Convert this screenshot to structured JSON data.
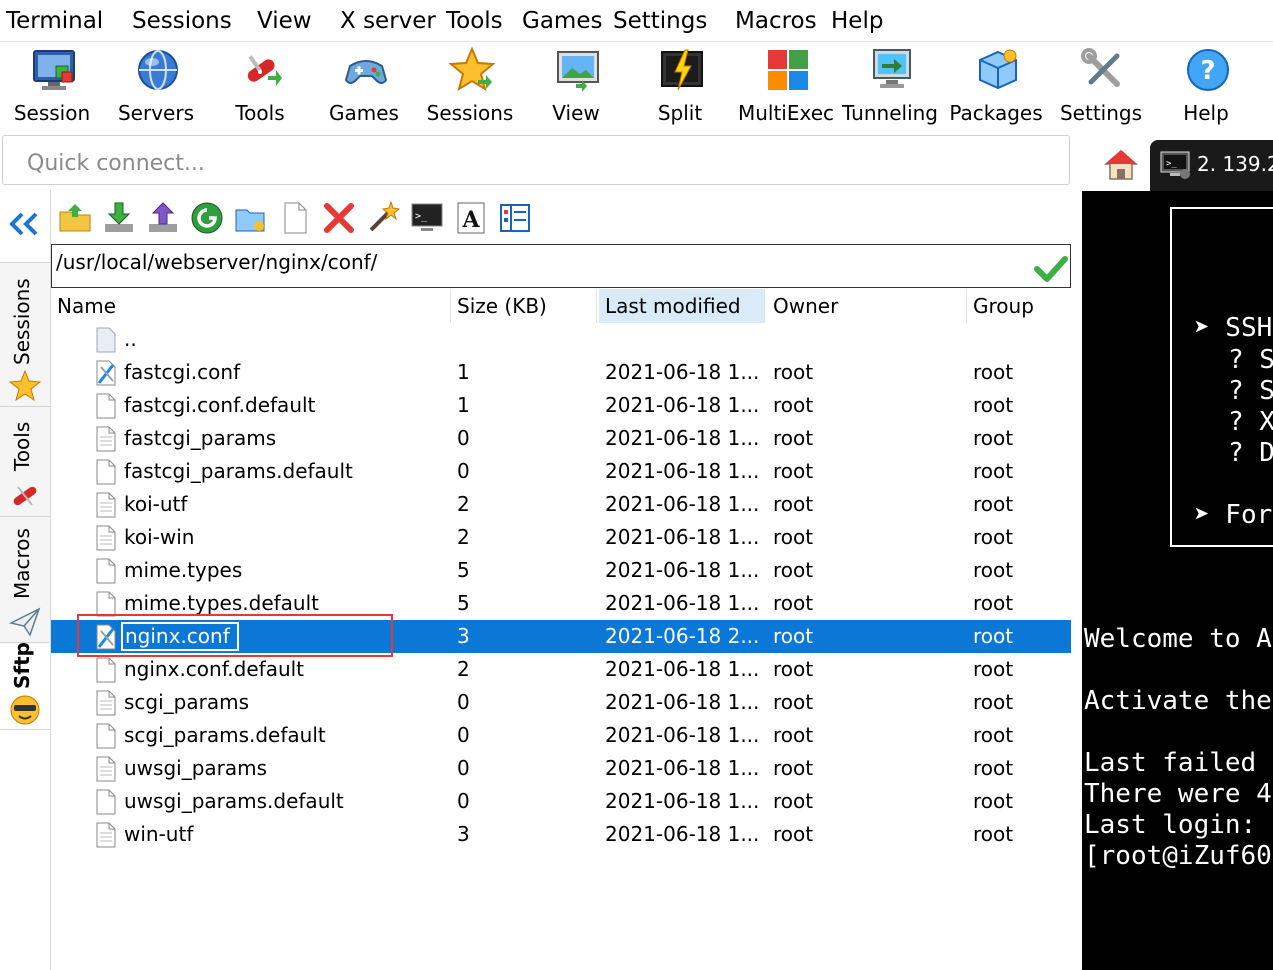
{
  "menu": [
    "Terminal",
    "Sessions",
    "View",
    "X server",
    "Tools",
    "Games",
    "Settings",
    "Macros",
    "Help"
  ],
  "toolbar": [
    "Session",
    "Servers",
    "Tools",
    "Games",
    "Sessions",
    "View",
    "Split",
    "MultiExec",
    "Tunneling",
    "Packages",
    "Settings",
    "Help"
  ],
  "quick_connect": {
    "placeholder": "Quick connect..."
  },
  "terminal_tab": {
    "label": "2. 139.2"
  },
  "sidebar_tabs": [
    "Sessions",
    "Tools",
    "Macros",
    "Sftp"
  ],
  "sftp": {
    "path": "/usr/local/webserver/nginx/conf/",
    "columns": {
      "name": "Name",
      "size": "Size (KB)",
      "modified": "Last modified",
      "owner": "Owner",
      "group": "Group"
    },
    "parent": "..",
    "files": [
      {
        "name": "fastcgi.conf",
        "size": "1",
        "modified": "2021-06-18 1...",
        "owner": "root",
        "group": "root",
        "icon": "conf-file-icon"
      },
      {
        "name": "fastcgi.conf.default",
        "size": "1",
        "modified": "2021-06-18 1...",
        "owner": "root",
        "group": "root",
        "icon": "blank-file-icon"
      },
      {
        "name": "fastcgi_params",
        "size": "0",
        "modified": "2021-06-18 1...",
        "owner": "root",
        "group": "root",
        "icon": "text-file-icon"
      },
      {
        "name": "fastcgi_params.default",
        "size": "0",
        "modified": "2021-06-18 1...",
        "owner": "root",
        "group": "root",
        "icon": "blank-file-icon"
      },
      {
        "name": "koi-utf",
        "size": "2",
        "modified": "2021-06-18 1...",
        "owner": "root",
        "group": "root",
        "icon": "text-file-icon"
      },
      {
        "name": "koi-win",
        "size": "2",
        "modified": "2021-06-18 1...",
        "owner": "root",
        "group": "root",
        "icon": "text-file-icon"
      },
      {
        "name": "mime.types",
        "size": "5",
        "modified": "2021-06-18 1...",
        "owner": "root",
        "group": "root",
        "icon": "blank-file-icon"
      },
      {
        "name": "mime.types.default",
        "size": "5",
        "modified": "2021-06-18 1...",
        "owner": "root",
        "group": "root",
        "icon": "blank-file-icon"
      },
      {
        "name": "nginx.conf",
        "size": "3",
        "modified": "2021-06-18 2...",
        "owner": "root",
        "group": "root",
        "icon": "conf-file-icon",
        "selected": true
      },
      {
        "name": "nginx.conf.default",
        "size": "2",
        "modified": "2021-06-18 1...",
        "owner": "root",
        "group": "root",
        "icon": "blank-file-icon"
      },
      {
        "name": "scgi_params",
        "size": "0",
        "modified": "2021-06-18 1...",
        "owner": "root",
        "group": "root",
        "icon": "text-file-icon"
      },
      {
        "name": "scgi_params.default",
        "size": "0",
        "modified": "2021-06-18 1...",
        "owner": "root",
        "group": "root",
        "icon": "blank-file-icon"
      },
      {
        "name": "uwsgi_params",
        "size": "0",
        "modified": "2021-06-18 1...",
        "owner": "root",
        "group": "root",
        "icon": "text-file-icon"
      },
      {
        "name": "uwsgi_params.default",
        "size": "0",
        "modified": "2021-06-18 1...",
        "owner": "root",
        "group": "root",
        "icon": "blank-file-icon"
      },
      {
        "name": "win-utf",
        "size": "3",
        "modified": "2021-06-18 1...",
        "owner": "root",
        "group": "root",
        "icon": "text-file-icon"
      }
    ]
  },
  "terminal": {
    "box_lines": [
      "➤ SSH",
      "? S",
      "? S",
      "? X",
      "? D",
      "➤ For"
    ],
    "lines": [
      "Welcome to A",
      "Activate the",
      "Last failed",
      "There were 4",
      "Last login:",
      "[root@iZuf60"
    ]
  },
  "colors": {
    "selection": "#0b78d7",
    "highlight_rect": "#e53935",
    "terminal_bg": "#000000",
    "sorted_header": "#d9eaf8"
  }
}
